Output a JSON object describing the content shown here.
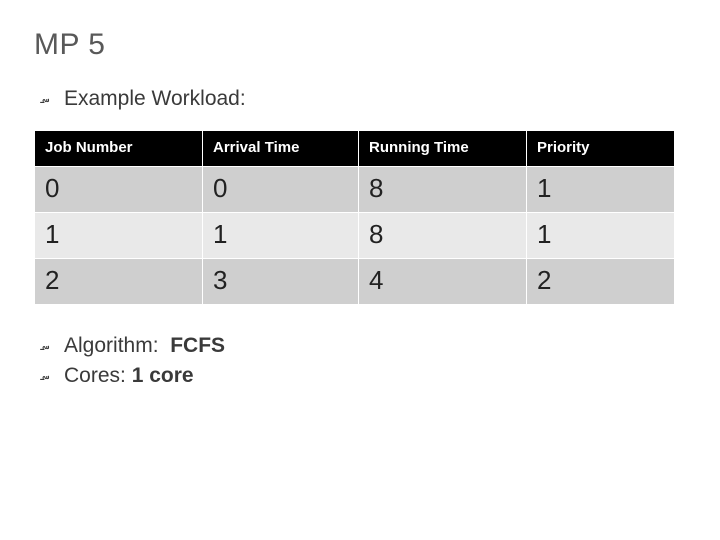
{
  "title": "MP 5",
  "bullets": {
    "workload": "Example Workload:",
    "algorithm_label": "Algorithm:",
    "algorithm_value": "FCFS",
    "cores_label": "Cores:",
    "cores_value": "1 core"
  },
  "bullet_glyph": "؄",
  "table": {
    "headers": [
      "Job Number",
      "Arrival Time",
      "Running Time",
      "Priority"
    ],
    "rows": [
      [
        "0",
        "0",
        "8",
        "1"
      ],
      [
        "1",
        "1",
        "8",
        "1"
      ],
      [
        "2",
        "3",
        "4",
        "2"
      ]
    ]
  },
  "chart_data": {
    "type": "table",
    "title": "Example Workload",
    "columns": [
      "Job Number",
      "Arrival Time",
      "Running Time",
      "Priority"
    ],
    "rows": [
      {
        "Job Number": 0,
        "Arrival Time": 0,
        "Running Time": 8,
        "Priority": 1
      },
      {
        "Job Number": 1,
        "Arrival Time": 1,
        "Running Time": 8,
        "Priority": 1
      },
      {
        "Job Number": 2,
        "Arrival Time": 3,
        "Running Time": 4,
        "Priority": 2
      }
    ],
    "algorithm": "FCFS",
    "cores": 1
  }
}
